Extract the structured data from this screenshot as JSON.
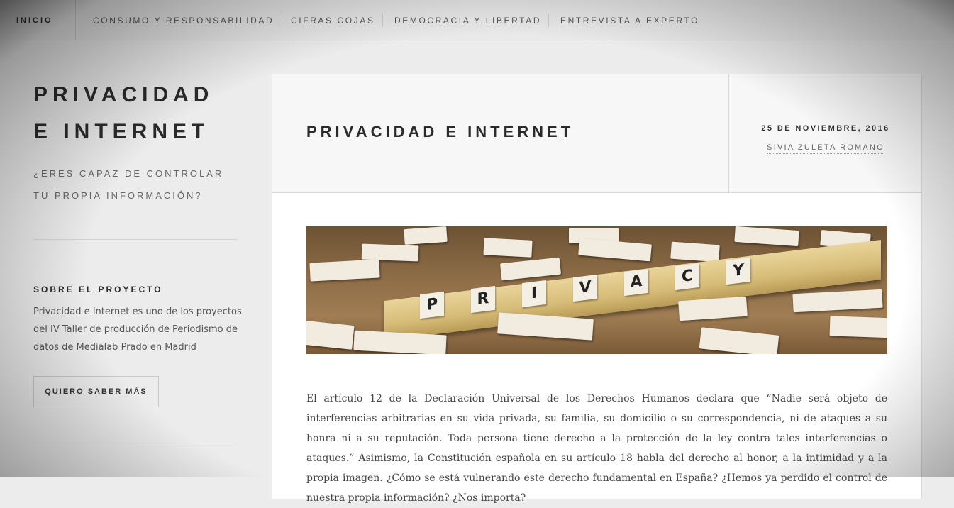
{
  "nav": {
    "items": [
      {
        "label": "INICIO"
      },
      {
        "label": "CONSUMO Y RESPONSABILIDAD"
      },
      {
        "label": "CIFRAS COJAS"
      },
      {
        "label": "DEMOCRACIA Y LIBERTAD"
      },
      {
        "label": "ENTREVISTA A EXPERTO"
      }
    ]
  },
  "sidebar": {
    "site_title_line1": "PRIVACIDAD",
    "site_title_line2": "E INTERNET",
    "tagline_line1": "¿ERES CAPAZ DE CONTROLAR",
    "tagline_line2": "TU PROPIA INFORMACIÓN?",
    "widget_title": "SOBRE EL PROYECTO",
    "widget_text_line1": "Privacidad e Internet es uno de los proyectos",
    "widget_text_line2": "del IV Taller de producción de Periodismo de",
    "widget_text_line3": "datos de Medialab Prado en Madrid",
    "button_label": "QUIERO SABER MÁS"
  },
  "article": {
    "title": "PRIVACIDAD E INTERNET",
    "date": "25 DE NOVIEMBRE, 2016",
    "author": "SIVIA ZULETA ROMANO",
    "image_word": "PRIVACY",
    "body": "El artículo 12 de la Declaración Universal de los Derechos Humanos declara que “Nadie será objeto de interferencias arbitrarias en su vida privada, su familia, su domicilio o su correspondencia, ni de ataques a su honra ni a su reputación. Toda persona tiene derecho a la protección de la ley contra tales interferencias o ataques.” Asimismo, la Constitución española en su artículo 18 habla del derecho al honor, a la intimidad y a la propia imagen. ¿Cómo se está vulnerando este derecho fundamental en España? ¿Hemos ya perdido el control de nuestra propia información? ¿Nos importa?"
  },
  "colors": {
    "background": "#ececec",
    "text_dark": "#2b2b2b",
    "text_muted": "#666666"
  }
}
